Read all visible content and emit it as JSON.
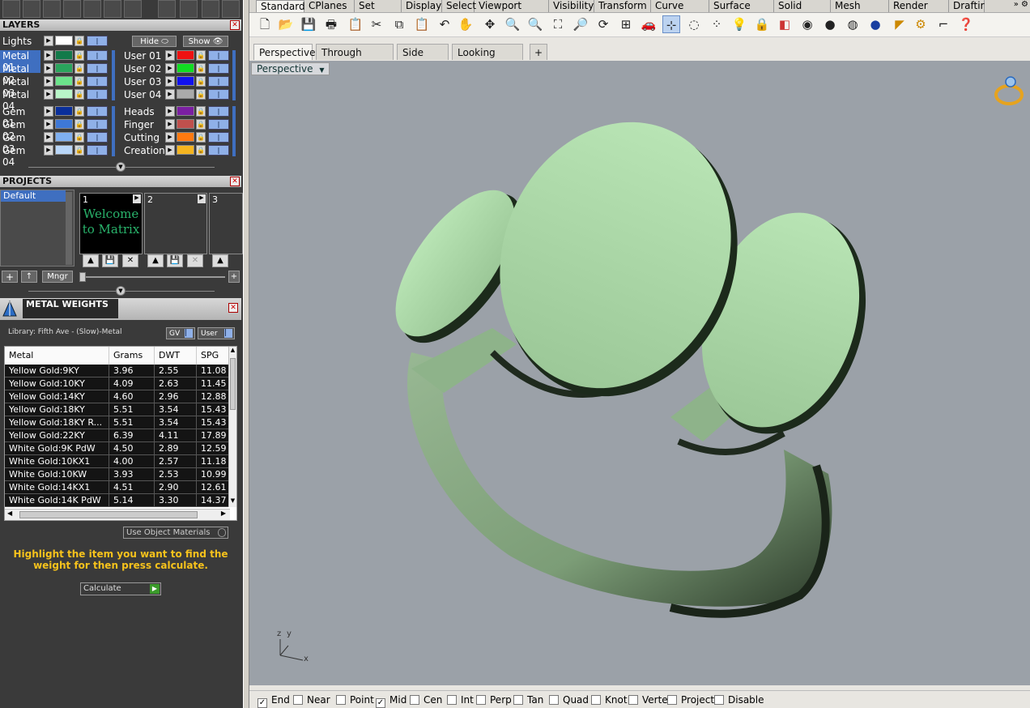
{
  "ribbon_tabs": [
    "Standard",
    "CPlanes",
    "Set View",
    "Display",
    "Select",
    "Viewport Layout",
    "Visibility",
    "Transform",
    "Curve Tools",
    "Surface Tools",
    "Solid Tools",
    "Mesh Tools",
    "Render Tools",
    "Draftir"
  ],
  "layers": {
    "title": "LAYERS",
    "lights": "Lights",
    "hide": "Hide",
    "show": "Show",
    "left": [
      {
        "name": "Metal 01",
        "color": "#127a4a",
        "selected": true
      },
      {
        "name": "Metal 02",
        "color": "#2aa55c"
      },
      {
        "name": "Metal 03",
        "color": "#6be38a"
      },
      {
        "name": "Metal 04",
        "color": "#b8f5c8"
      },
      {
        "name": "Gem 01",
        "color": "#0a2f9a"
      },
      {
        "name": "Gem 02",
        "color": "#3e78d6"
      },
      {
        "name": "Gem 03",
        "color": "#7fb0f0"
      },
      {
        "name": "Gem 04",
        "color": "#b9d6f8"
      }
    ],
    "right": [
      {
        "name": "User 01",
        "color": "#ee1111"
      },
      {
        "name": "User 02",
        "color": "#11dd22"
      },
      {
        "name": "User 03",
        "color": "#1111ee"
      },
      {
        "name": "User 04",
        "color": "#aaaaaa"
      },
      {
        "name": "Heads",
        "color": "#7b1fa2"
      },
      {
        "name": "Finger",
        "color": "#c0504d"
      },
      {
        "name": "Cutting",
        "color": "#ff7a10"
      },
      {
        "name": "Creation",
        "color": "#f5b520"
      }
    ]
  },
  "projects": {
    "title": "PROJECTS",
    "list": [
      "Default"
    ],
    "thumbs": [
      {
        "num": "1",
        "text": "Welcome to Matrix"
      },
      {
        "num": "2",
        "text": ""
      },
      {
        "num": "3",
        "text": ""
      }
    ],
    "mngr": "Mngr"
  },
  "metal_weights": {
    "title": "METAL WEIGHTS",
    "library": "Library: Fifth Ave - (Slow)-Metal",
    "gv": "GV",
    "user": "User",
    "columns": [
      "Metal",
      "Grams",
      "DWT",
      "SPG"
    ],
    "rows": [
      [
        "Yellow Gold:9KY",
        "3.96",
        "2.55",
        "11.08"
      ],
      [
        "Yellow Gold:10KY",
        "4.09",
        "2.63",
        "11.45"
      ],
      [
        "Yellow Gold:14KY",
        "4.60",
        "2.96",
        "12.88"
      ],
      [
        "Yellow Gold:18KY",
        "5.51",
        "3.54",
        "15.43"
      ],
      [
        "Yellow Gold:18KY R...",
        "5.51",
        "3.54",
        "15.43"
      ],
      [
        "Yellow Gold:22KY",
        "6.39",
        "4.11",
        "17.89"
      ],
      [
        "White Gold:9K PdW",
        "4.50",
        "2.89",
        "12.59"
      ],
      [
        "White Gold:10KX1",
        "4.00",
        "2.57",
        "11.18"
      ],
      [
        "White Gold:10KW",
        "3.93",
        "2.53",
        "10.99"
      ],
      [
        "White Gold:14KX1",
        "4.51",
        "2.90",
        "12.61"
      ],
      [
        "White Gold:14K PdW",
        "5.14",
        "3.30",
        "14.37"
      ]
    ],
    "use_object": "Use Object Materials",
    "hint": "Highlight the item you want to find the weight for then press calculate.",
    "calculate": "Calculate"
  },
  "viewport_tabs": [
    "Perspective",
    "Through Finger",
    "Side View",
    "Looking Down"
  ],
  "viewport_label": "Perspective",
  "axis": {
    "z": "z",
    "y": "y",
    "x": "x"
  },
  "osnaps": [
    {
      "label": "End",
      "checked": true
    },
    {
      "label": "Near",
      "checked": false
    },
    {
      "label": "Point",
      "checked": false
    },
    {
      "label": "Mid",
      "checked": true
    },
    {
      "label": "Cen",
      "checked": false
    },
    {
      "label": "Int",
      "checked": false
    },
    {
      "label": "Perp",
      "checked": false
    },
    {
      "label": "Tan",
      "checked": false
    },
    {
      "label": "Quad",
      "checked": false
    },
    {
      "label": "Knot",
      "checked": false
    },
    {
      "label": "Vertex",
      "checked": false
    },
    {
      "label": "Project",
      "checked": false
    },
    {
      "label": "Disable",
      "checked": false
    }
  ]
}
